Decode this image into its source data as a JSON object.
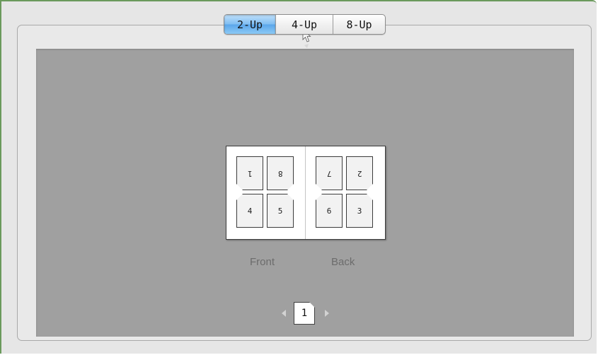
{
  "layout_selector": {
    "options": [
      "2-Up",
      "4-Up",
      "8-Up"
    ],
    "selected": "2-Up"
  },
  "preview": {
    "front_label": "Front",
    "back_label": "Back",
    "front_pages": [
      "1",
      "8",
      "4",
      "5"
    ],
    "back_pages": [
      "7",
      "2",
      "6",
      "3"
    ]
  },
  "pager": {
    "current_page": "1"
  },
  "colors": {
    "frame_border": "#6b9a5c",
    "preview_background": "#a0a0a0",
    "selected_segment": "#5aa6ea"
  },
  "icons": [
    "arrow-left-icon",
    "arrow-right-icon",
    "page-icon",
    "mouse-cursor-icon"
  ]
}
